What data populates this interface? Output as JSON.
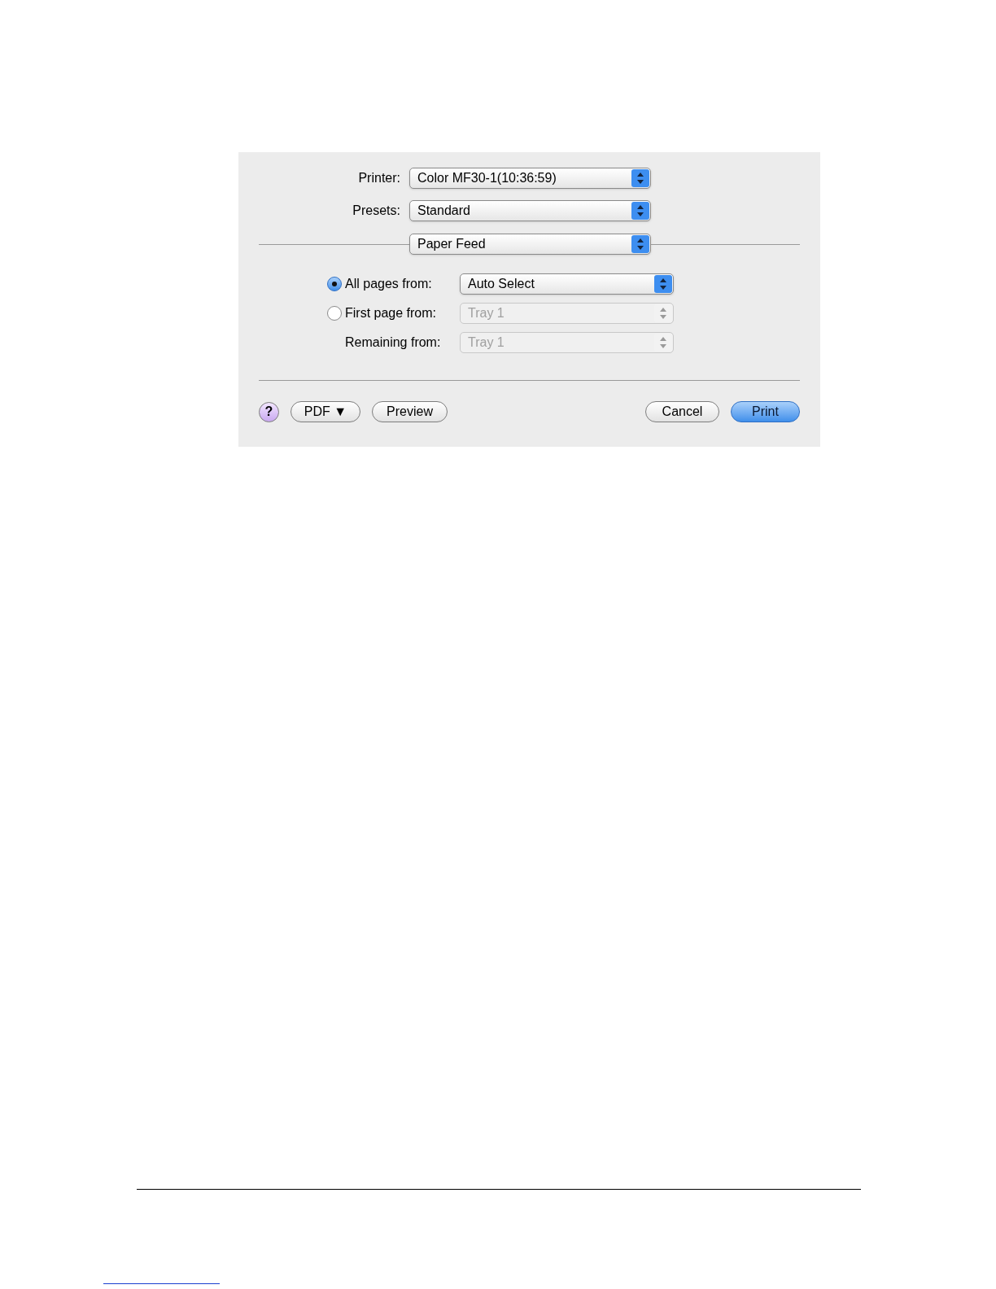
{
  "print_dialog": {
    "fields": [
      {
        "label": "Printer:",
        "value": "Color MF30-1(10:36:59)"
      },
      {
        "label": "Presets:",
        "value": "Standard"
      }
    ],
    "panel_menu": {
      "value": "Paper Feed"
    },
    "paper_sources": [
      {
        "kind": "radio",
        "label": "All pages from:",
        "selected": true,
        "value": "Auto Select",
        "disabled": false
      },
      {
        "kind": "radio",
        "label": "First page from:",
        "selected": false,
        "value": "Tray 1",
        "disabled": true
      },
      {
        "kind": "plain",
        "label": "Remaining from:",
        "value": "Tray 1",
        "disabled": true
      }
    ],
    "help_button": "?",
    "left_buttons": [
      {
        "label": "PDF ▼",
        "default": false
      },
      {
        "label": "Preview",
        "default": false
      }
    ],
    "right_buttons": [
      {
        "label": "Cancel",
        "default": false
      },
      {
        "label": "Print",
        "default": true
      }
    ]
  }
}
